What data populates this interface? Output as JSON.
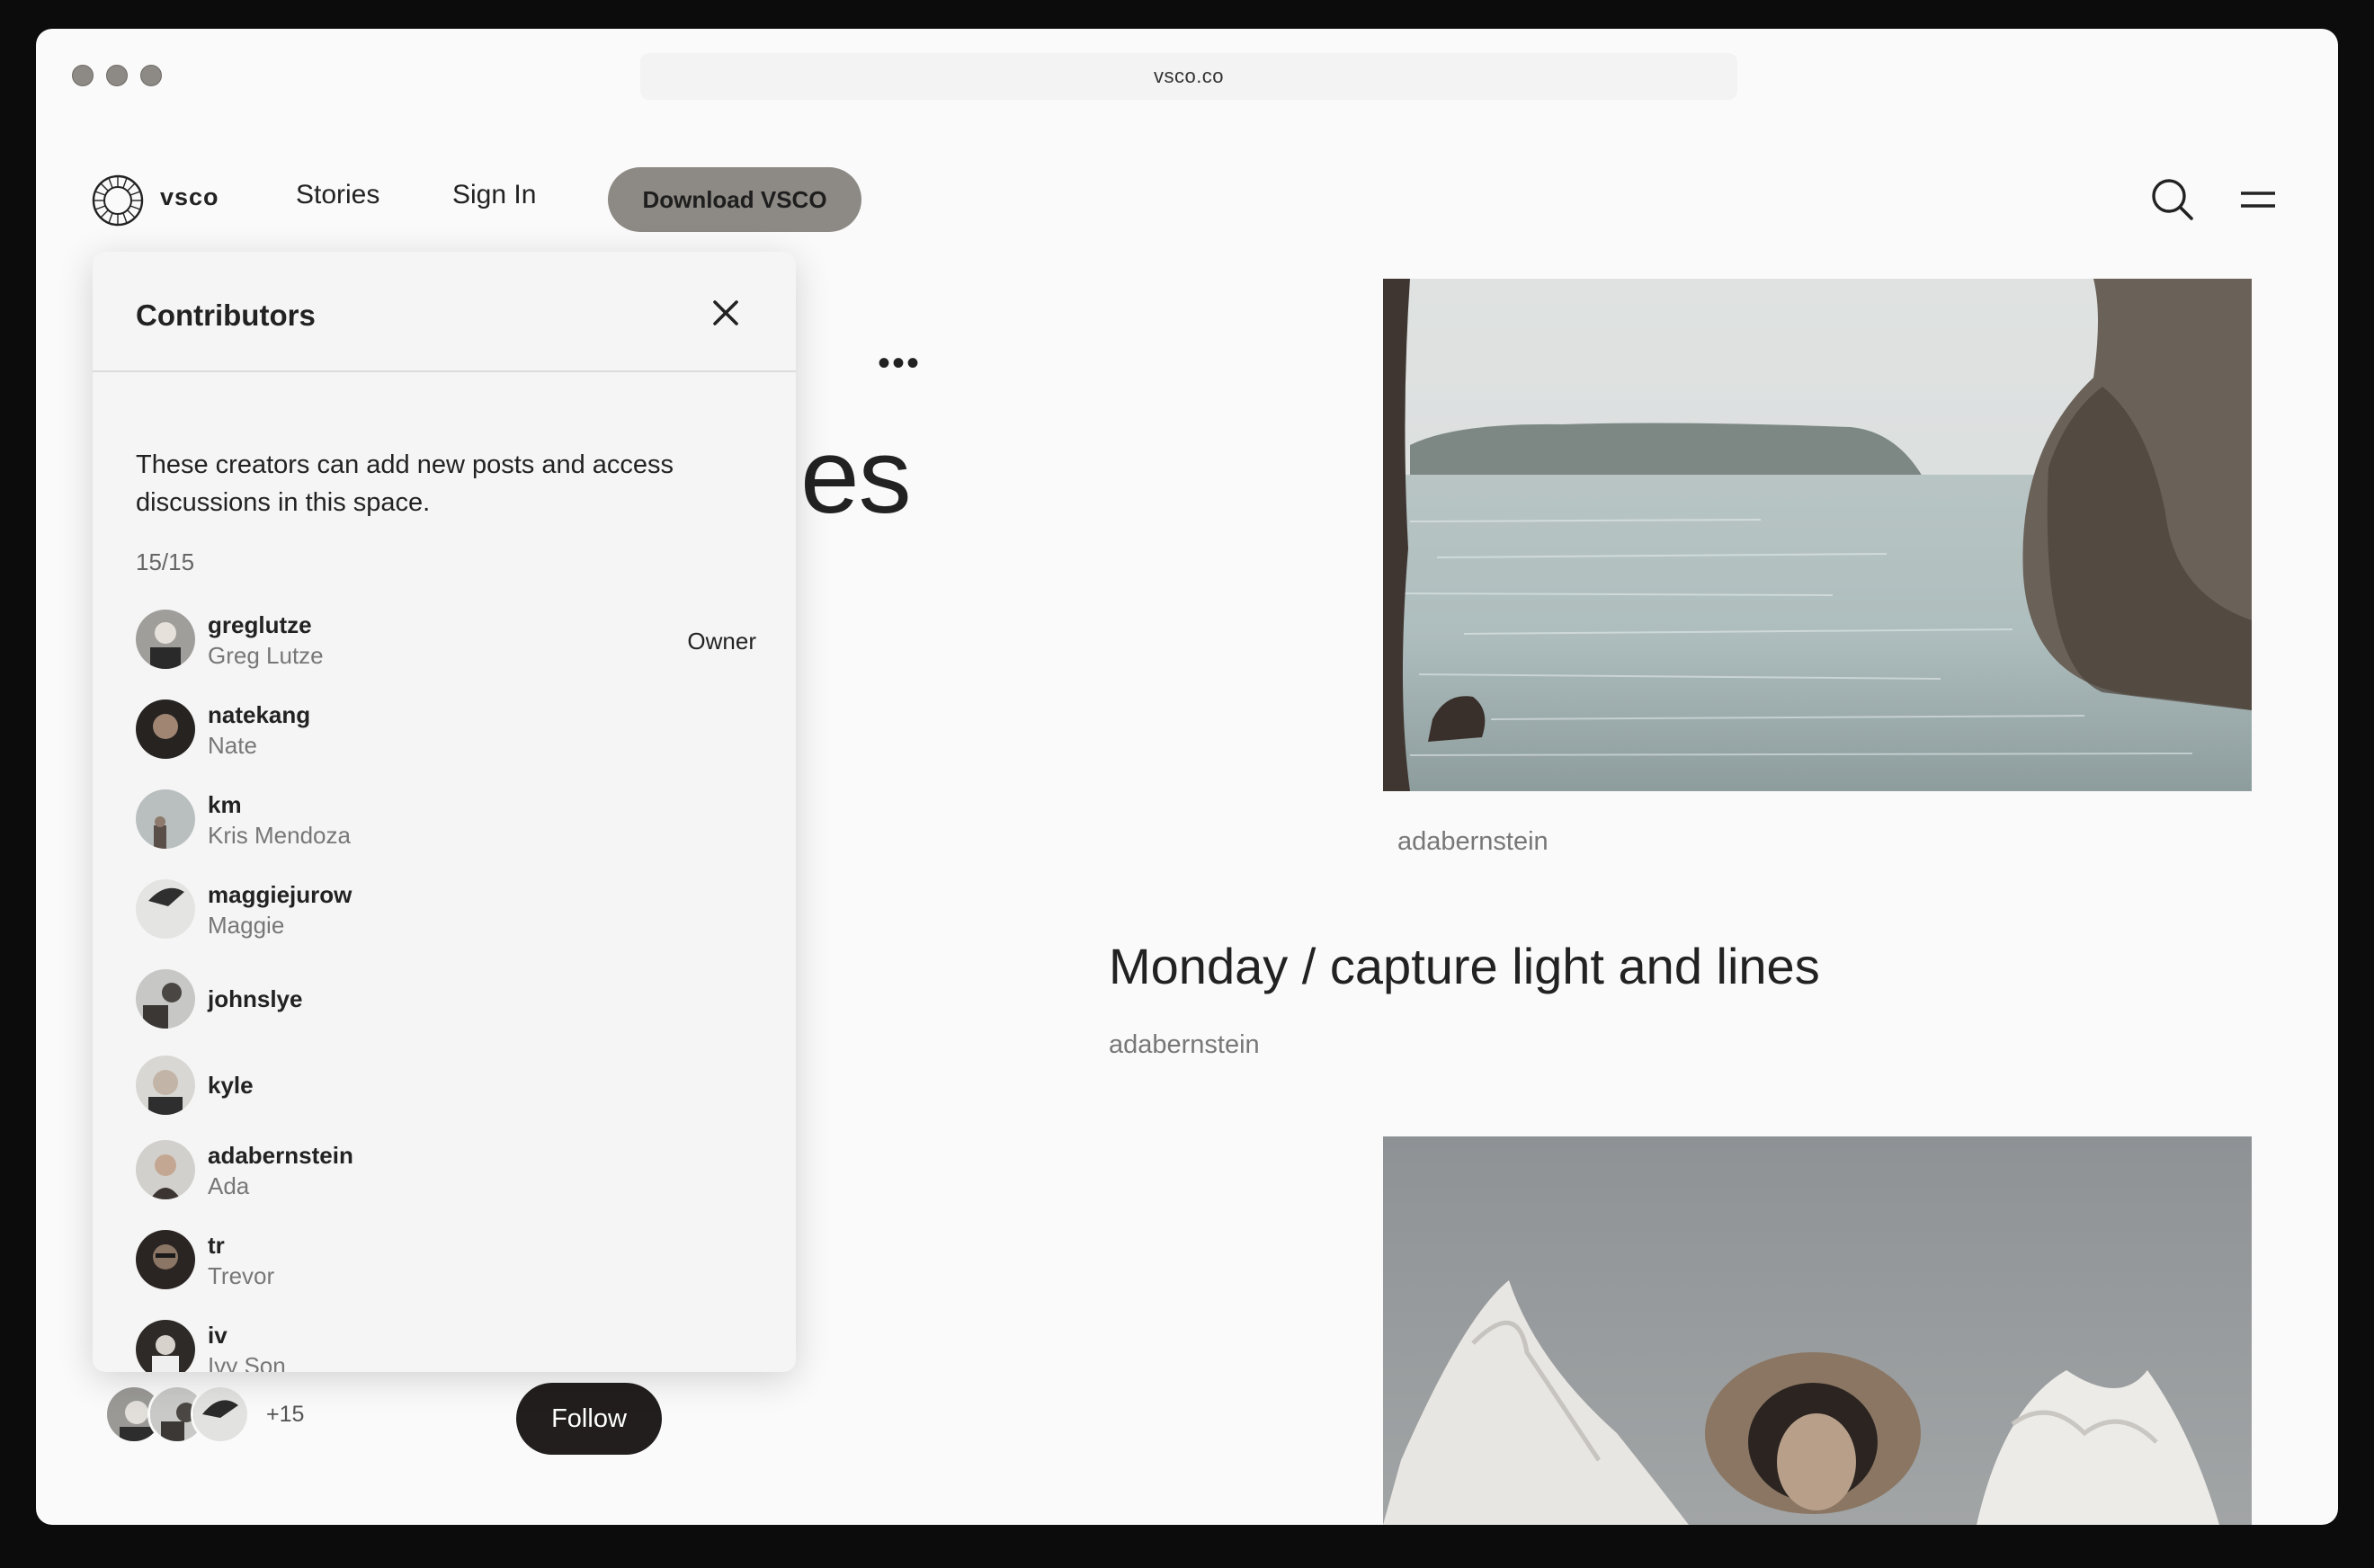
{
  "browser": {
    "url": "vsco.co"
  },
  "nav": {
    "logo_text": "vsco",
    "links": [
      "Stories",
      "Sign In"
    ],
    "download_label": "Download VSCO"
  },
  "page": {
    "title_fragment": "es",
    "more_label": "•••",
    "posts": [
      {
        "credit": "adabernstein"
      },
      {
        "title": "Monday / capture light and lines",
        "author": "adabernstein"
      }
    ],
    "avatars_more": "+15",
    "follow_label": "Follow"
  },
  "panel": {
    "title": "Contributors",
    "description": "These creators can add new posts and access discussions in this space.",
    "count": "15/15",
    "contributors": [
      {
        "username": "greglutze",
        "name": "Greg Lutze",
        "role": "Owner"
      },
      {
        "username": "natekang",
        "name": "Nate"
      },
      {
        "username": "km",
        "name": "Kris Mendoza"
      },
      {
        "username": "maggiejurow",
        "name": "Maggie"
      },
      {
        "username": "johnslye"
      },
      {
        "username": "kyle"
      },
      {
        "username": "adabernstein",
        "name": "Ada"
      },
      {
        "username": "tr",
        "name": "Trevor"
      },
      {
        "username": "iv",
        "name": "Ivy Son"
      }
    ]
  },
  "colors": {
    "button_gray": "#8d8984",
    "follow_dark": "#221e1e"
  }
}
